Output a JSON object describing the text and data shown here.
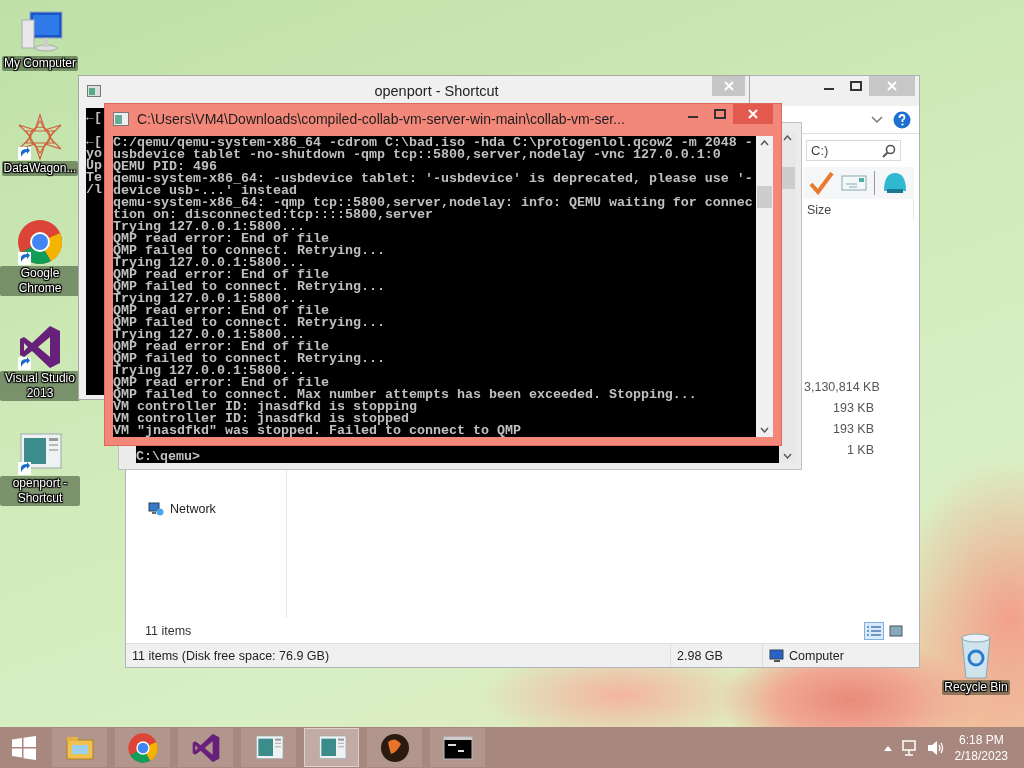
{
  "desktop_icons": [
    {
      "kind": "computer",
      "label": "My Computer",
      "shortcut": false
    },
    {
      "kind": "datawagon",
      "label": "DataWagon...",
      "shortcut": true
    },
    {
      "kind": "chrome",
      "label": "Google Chrome",
      "shortcut": true
    },
    {
      "kind": "visualstudio",
      "label": "Visual Studio 2013",
      "shortcut": true
    },
    {
      "kind": "openport",
      "label": "openport - Shortcut",
      "shortcut": true
    }
  ],
  "recycle_bin": {
    "label": "Recycle Bin"
  },
  "explorer": {
    "search_value": "C:)",
    "column_header": "Size",
    "sizes": [
      "3,130,814 KB",
      "193 KB",
      "193 KB",
      "1 KB"
    ],
    "nav_items": [
      {
        "label": "Network"
      }
    ],
    "item_count": "11 items",
    "view_buttons": [
      {
        "kind": "details",
        "selected": true
      },
      {
        "kind": "large_icons",
        "selected": false
      }
    ],
    "status_bar": {
      "summary": "11 items (Disk free space: 76.9 GB)",
      "size": "2.98 GB",
      "location": "Computer"
    }
  },
  "back_console": {
    "prompt": "C:\\qemu>"
  },
  "openport_window": {
    "title": "openport - Shortcut",
    "lines": [
      "←[",
      "←[",
      "yo",
      "Up",
      "Te",
      "/l"
    ]
  },
  "console": {
    "title": "C:\\Users\\VM4\\Downloads\\compiled-collab-vm-server-win-main\\collab-vm-ser...",
    "lines": [
      "C:/qemu/qemu-system-x86_64 -cdrom C:\\bad.iso -hda C:\\protogenlol.qcow2 -m 2048 -",
      "usbdevice tablet -no-shutdown -qmp tcp::5800,server,nodelay -vnc 127.0.0.1:0",
      "QEMU PID: 496",
      "qemu-system-x86_64: -usbdevice tablet: '-usbdevice' is deprecated, please use '-",
      "device usb-...' instead",
      "qemu-system-x86_64: -qmp tcp::5800,server,nodelay: info: QEMU waiting for connec",
      "tion on: disconnected:tcp::::5800,server",
      "Trying 127.0.0.1:5800...",
      "QMP read error: End of file",
      "QMP failed to connect. Retrying...",
      "Trying 127.0.0.1:5800...",
      "QMP read error: End of file",
      "QMP failed to connect. Retrying...",
      "Trying 127.0.0.1:5800...",
      "QMP read error: End of file",
      "QMP failed to connect. Retrying...",
      "Trying 127.0.0.1:5800...",
      "QMP read error: End of file",
      "QMP failed to connect. Retrying...",
      "Trying 127.0.0.1:5800...",
      "QMP read error: End of file",
      "QMP failed to connect. Max number attempts has been exceeded. Stopping...",
      "VM controller ID: jnasdfkd is stopping",
      "VM controller ID: jnasdfkd is stopped",
      "VM \"jnasdfkd\" was stopped. Failed to connect to QMP"
    ]
  },
  "taskbar": {
    "apps": [
      {
        "kind": "explorer",
        "active": false
      },
      {
        "kind": "chrome",
        "active": false
      },
      {
        "kind": "visualstudio",
        "active": false
      },
      {
        "kind": "openport",
        "active": false
      },
      {
        "kind": "openport",
        "active": true
      },
      {
        "kind": "qemu",
        "active": false
      },
      {
        "kind": "cmd",
        "active": false
      }
    ],
    "clock": {
      "time": "6:18 PM",
      "date": "2/18/2023"
    }
  }
}
